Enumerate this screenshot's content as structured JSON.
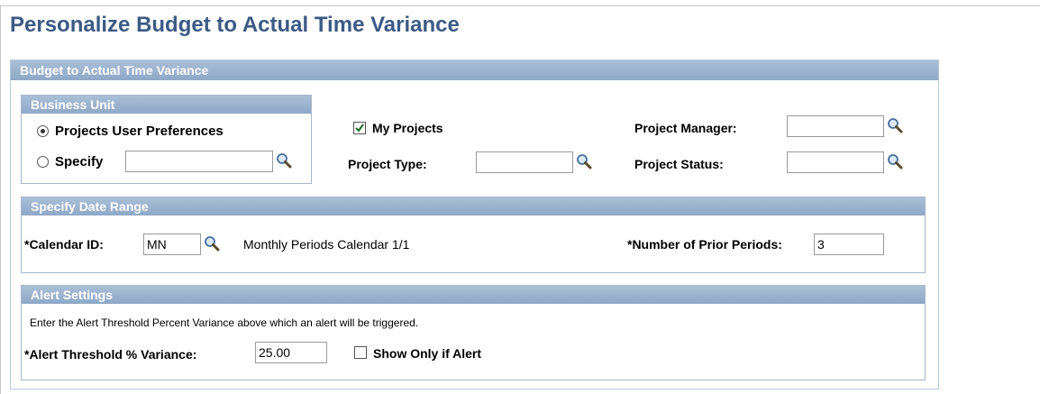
{
  "page": {
    "title": "Personalize Budget to Actual Time Variance"
  },
  "panel": {
    "title": "Budget to Actual Time Variance"
  },
  "business_unit": {
    "title": "Business Unit",
    "option_preferences": "Projects User Preferences",
    "option_specify": "Specify",
    "selected": "Projects User Preferences",
    "specify_value": ""
  },
  "filters": {
    "my_projects_label": "My Projects",
    "my_projects_checked": true,
    "project_type_label": "Project Type:",
    "project_type_value": "",
    "project_manager_label": "Project Manager:",
    "project_manager_value": "",
    "project_status_label": "Project Status:",
    "project_status_value": ""
  },
  "date_range": {
    "title": "Specify Date Range",
    "calendar_id_label": "*Calendar ID:",
    "calendar_id_value": "MN",
    "calendar_description": "Monthly Periods Calendar 1/1",
    "prior_periods_label": "*Number of Prior Periods:",
    "prior_periods_value": "3"
  },
  "alert": {
    "title": "Alert Settings",
    "instruction": "Enter the Alert Threshold Percent Variance above which an alert will be triggered.",
    "threshold_label": "*Alert Threshold % Variance:",
    "threshold_value": "25.00",
    "show_only_label": "Show Only if Alert",
    "show_only_checked": false
  },
  "icons": {
    "lookup": "magnifier-lookup-icon",
    "check": "checkmark-icon"
  },
  "colors": {
    "title": "#3c5a85",
    "bar_top": "#aabfd7",
    "bar_bottom": "#8ea8c7",
    "border": "#a8b7c9"
  }
}
